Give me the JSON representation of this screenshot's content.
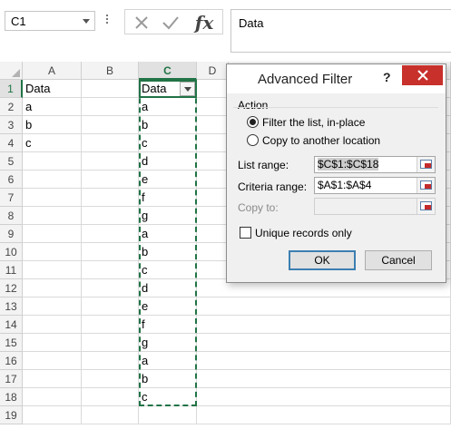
{
  "formula_bar": {
    "name_box": "C1",
    "formula": "Data",
    "fx_label": "fx"
  },
  "columns": [
    "A",
    "B",
    "C",
    "D"
  ],
  "selected_column": "C",
  "rows": [
    "1",
    "2",
    "3",
    "4",
    "5",
    "6",
    "7",
    "8",
    "9",
    "10",
    "11",
    "12",
    "13",
    "14",
    "15",
    "16",
    "17",
    "18",
    "19"
  ],
  "column_a": [
    "Data",
    "a",
    "b",
    "c"
  ],
  "column_c": [
    "Data",
    "a",
    "b",
    "c",
    "d",
    "e",
    "f",
    "g",
    "a",
    "b",
    "c",
    "d",
    "e",
    "f",
    "g",
    "a",
    "b",
    "c"
  ],
  "dialog": {
    "title": "Advanced Filter",
    "help": "?",
    "action_label": "Action",
    "radio_filter": "Filter the list, in-place",
    "radio_copy": "Copy to another location",
    "list_range_label": "List range:",
    "list_range_value": "$C$1:$C$18",
    "criteria_range_label": "Criteria range:",
    "criteria_range_value": "$A$1:$A$4",
    "copy_to_label": "Copy to:",
    "copy_to_value": "",
    "unique_label": "Unique records only",
    "ok_label": "OK",
    "cancel_label": "Cancel"
  },
  "colors": {
    "accent_green": "#217346",
    "close_red": "#c7302b"
  }
}
